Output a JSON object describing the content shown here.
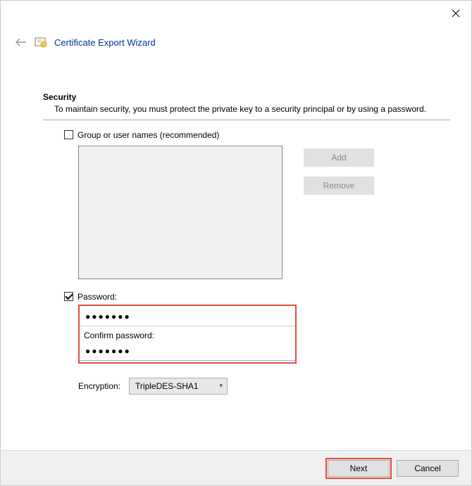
{
  "window": {
    "title": "Certificate Export Wizard"
  },
  "section": {
    "title": "Security",
    "description": "To maintain security, you must protect the private key to a security principal or by using a password."
  },
  "group_names": {
    "label": "Group or user names (recommended)",
    "checked": false
  },
  "buttons": {
    "add": "Add",
    "remove": "Remove",
    "next": "Next",
    "cancel": "Cancel"
  },
  "password": {
    "label": "Password:",
    "checked": true,
    "value": "●●●●●●●",
    "confirm_label": "Confirm password:",
    "confirm_value": "●●●●●●●"
  },
  "encryption": {
    "label": "Encryption:",
    "value": "TripleDES-SHA1"
  }
}
